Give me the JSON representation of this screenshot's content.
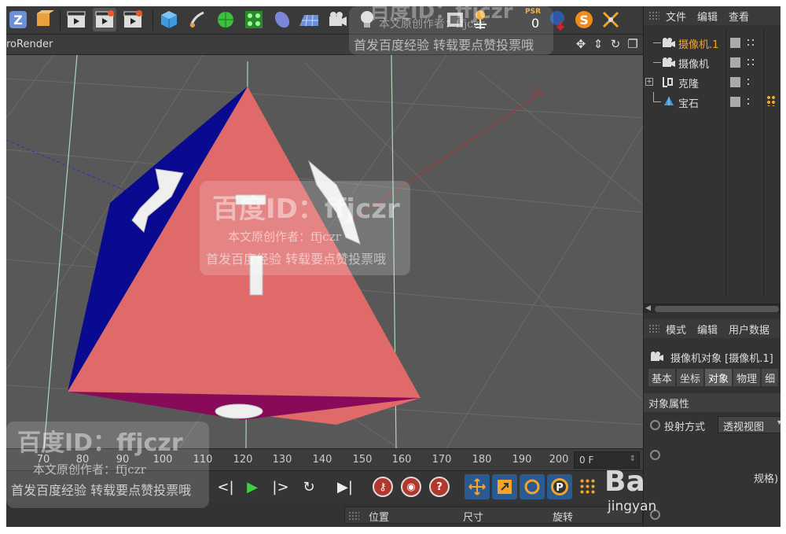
{
  "viewport": {
    "title": "roRender",
    "nav_icons": [
      "move-icon",
      "pan-icon",
      "rotate-icon",
      "maximize-icon"
    ]
  },
  "toolbar": {
    "counter_label": "PSR",
    "counter_value": "0"
  },
  "timeline": {
    "ticks": [
      "70",
      "80",
      "90",
      "100",
      "110",
      "120",
      "130",
      "140",
      "150",
      "160",
      "170",
      "180",
      "190",
      "200"
    ],
    "current_frame": "0 F"
  },
  "coords": {
    "position_label": "位置",
    "size_label": "尺寸",
    "rotation_label": "旋转"
  },
  "object_manager": {
    "menu": [
      "文件",
      "编辑",
      "查看"
    ],
    "objects": [
      {
        "name": "摄像机.1",
        "active": true
      },
      {
        "name": "摄像机",
        "active": false
      },
      {
        "name": "克隆",
        "active": false
      },
      {
        "name": "宝石",
        "active": false
      }
    ]
  },
  "attributes": {
    "menu": [
      "模式",
      "编辑",
      "用户数据"
    ],
    "title": "摄像机对象 [摄像机.1]",
    "tabs": [
      "基本",
      "坐标",
      "对象",
      "物理",
      "细"
    ],
    "active_tab": "对象",
    "section": "对象属性",
    "projection_label": "投射方式",
    "projection_value": "透视视图",
    "partial_text": "规格)"
  },
  "watermarks": {
    "brand": "百度ID：ffjczr",
    "brand_top": "百度ID：ffjczr",
    "author": "本文原创作者：ffjczr",
    "notice": "首发百度经验  转载要点赞投票哦",
    "author_short": "本文原创作者：ffjczr",
    "notice_small": "首发百度经验  转载要点赞投票哦",
    "logo": "Ba",
    "logo_sub": "jingyan"
  },
  "colors": {
    "front_face": "#e06a6a",
    "left_face": "#0a0a90",
    "right_face": "#1e6e1e",
    "bottom_face": "#8a0a5a",
    "accent_orange": "#f2a52a",
    "active_item": "#f2a52a"
  }
}
